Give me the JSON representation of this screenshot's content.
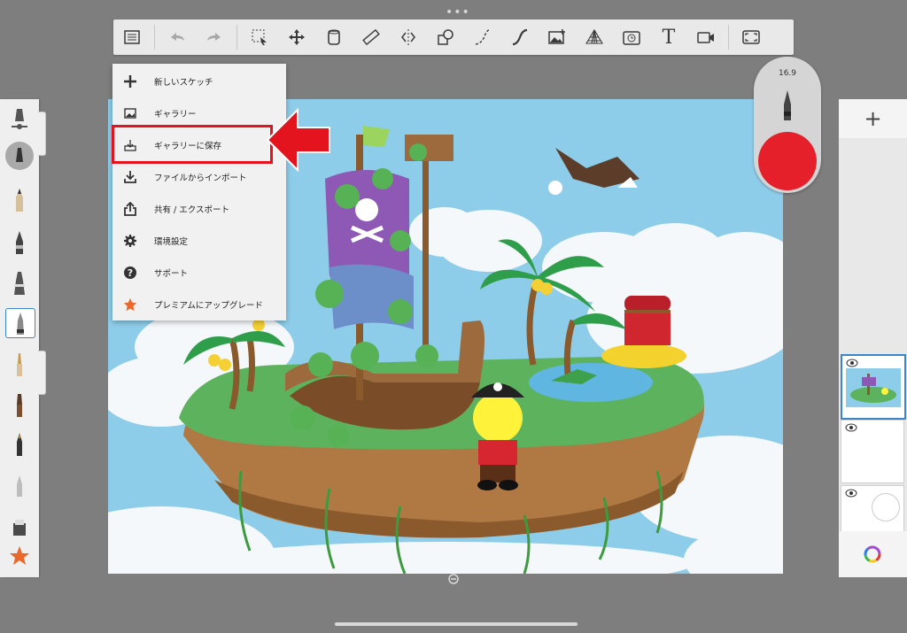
{
  "toolbar": {
    "icons": [
      "list-icon",
      "undo-icon",
      "redo-icon",
      "select-icon",
      "transform-icon",
      "layer-canister-icon",
      "ruler-icon",
      "symmetry-icon",
      "shapes-icon",
      "stroke-icon",
      "curve-icon",
      "image-add-icon",
      "perspective-icon",
      "timelapse-icon",
      "text-icon",
      "video-icon",
      "fullscreen-icon"
    ],
    "text_tool_label": "T"
  },
  "menu": {
    "items": [
      {
        "label": "新しいスケッチ",
        "icon": "plus-icon"
      },
      {
        "label": "ギャラリー",
        "icon": "gallery-icon"
      },
      {
        "label": "ギャラリーに保存",
        "icon": "save-to-gallery-icon"
      },
      {
        "label": "ファイルからインポート",
        "icon": "import-icon"
      },
      {
        "label": "共有 / エクスポート",
        "icon": "share-icon"
      },
      {
        "label": "環境設定",
        "icon": "gear-icon"
      },
      {
        "label": "サポート",
        "icon": "help-icon"
      },
      {
        "label": "プレミアムにアップグレード",
        "icon": "star-icon"
      }
    ],
    "highlighted_index": 2
  },
  "puck": {
    "brush_size": "16.9",
    "color": "#e5202a"
  },
  "layers_panel": {
    "add_label": "+",
    "layer_count": 3,
    "selected_index": 0
  },
  "colors": {
    "highlight": "#e3141e",
    "arrow": "#e3141e",
    "sky": "#8ecdea"
  }
}
